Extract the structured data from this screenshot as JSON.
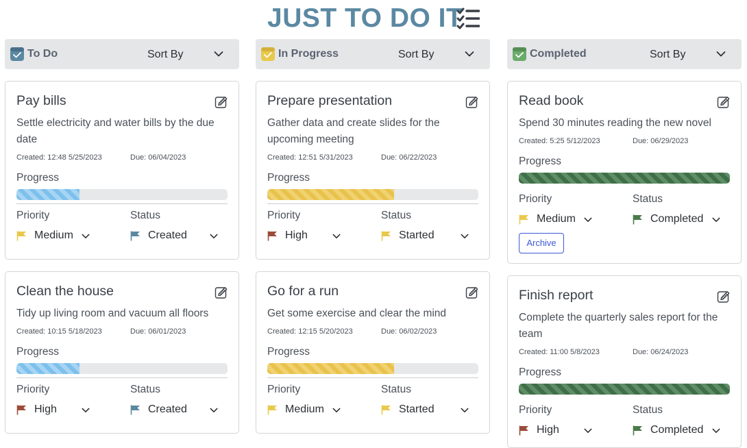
{
  "app": {
    "title": "JUST TO DO IT"
  },
  "sort_label": "Sort By",
  "labels": {
    "progress": "Progress",
    "priority": "Priority",
    "status": "Status",
    "archive": "Archive"
  },
  "colors": {
    "header_bg": "#e5e6e8",
    "title": "#5b88a2",
    "flag_medium": "#e9c94d",
    "flag_high": "#9c4c3a",
    "flag_created": "#5b88a2",
    "flag_started": "#e9c94d",
    "flag_completed": "#4b7a4b"
  },
  "columns": [
    {
      "title": "To Do",
      "cards": [
        {
          "title": "Pay bills",
          "description": "Settle electricity and water bills by the due date",
          "created": "Created: 12:48 5/25/2023",
          "due": "Due: 06/04/2023",
          "progress": 0.3,
          "priority": "Medium",
          "status": "Created"
        },
        {
          "title": "Clean the house",
          "description": "Tidy up living room and vacuum all floors",
          "created": "Created: 10:15 5/18/2023",
          "due": "Due: 06/01/2023",
          "progress": 0.3,
          "priority": "High",
          "status": "Created"
        }
      ]
    },
    {
      "title": "In Progress",
      "cards": [
        {
          "title": "Prepare presentation",
          "description": "Gather data and create slides for the upcoming meeting",
          "created": "Created: 12:51 5/31/2023",
          "due": "Due: 06/22/2023",
          "progress": 0.6,
          "priority": "High",
          "status": "Started"
        },
        {
          "title": "Go for a run",
          "description": "Get some exercise and clear the mind",
          "created": "Created: 12:15 5/20/2023",
          "due": "Due: 06/02/2023",
          "progress": 0.6,
          "priority": "Medium",
          "status": "Started"
        }
      ]
    },
    {
      "title": "Completed",
      "cards": [
        {
          "title": "Read book",
          "description": "Spend 30 minutes reading the new novel",
          "created": "Created: 5:25 5/12/2023",
          "due": "Due: 06/29/2023",
          "progress": 1.0,
          "priority": "Medium",
          "status": "Completed"
        },
        {
          "title": "Finish report",
          "description": "Complete the quarterly sales report for the team",
          "created": "Created: 11:00 5/8/2023",
          "due": "Due: 06/24/2023",
          "progress": 1.0,
          "priority": "High",
          "status": "Completed"
        }
      ]
    }
  ]
}
